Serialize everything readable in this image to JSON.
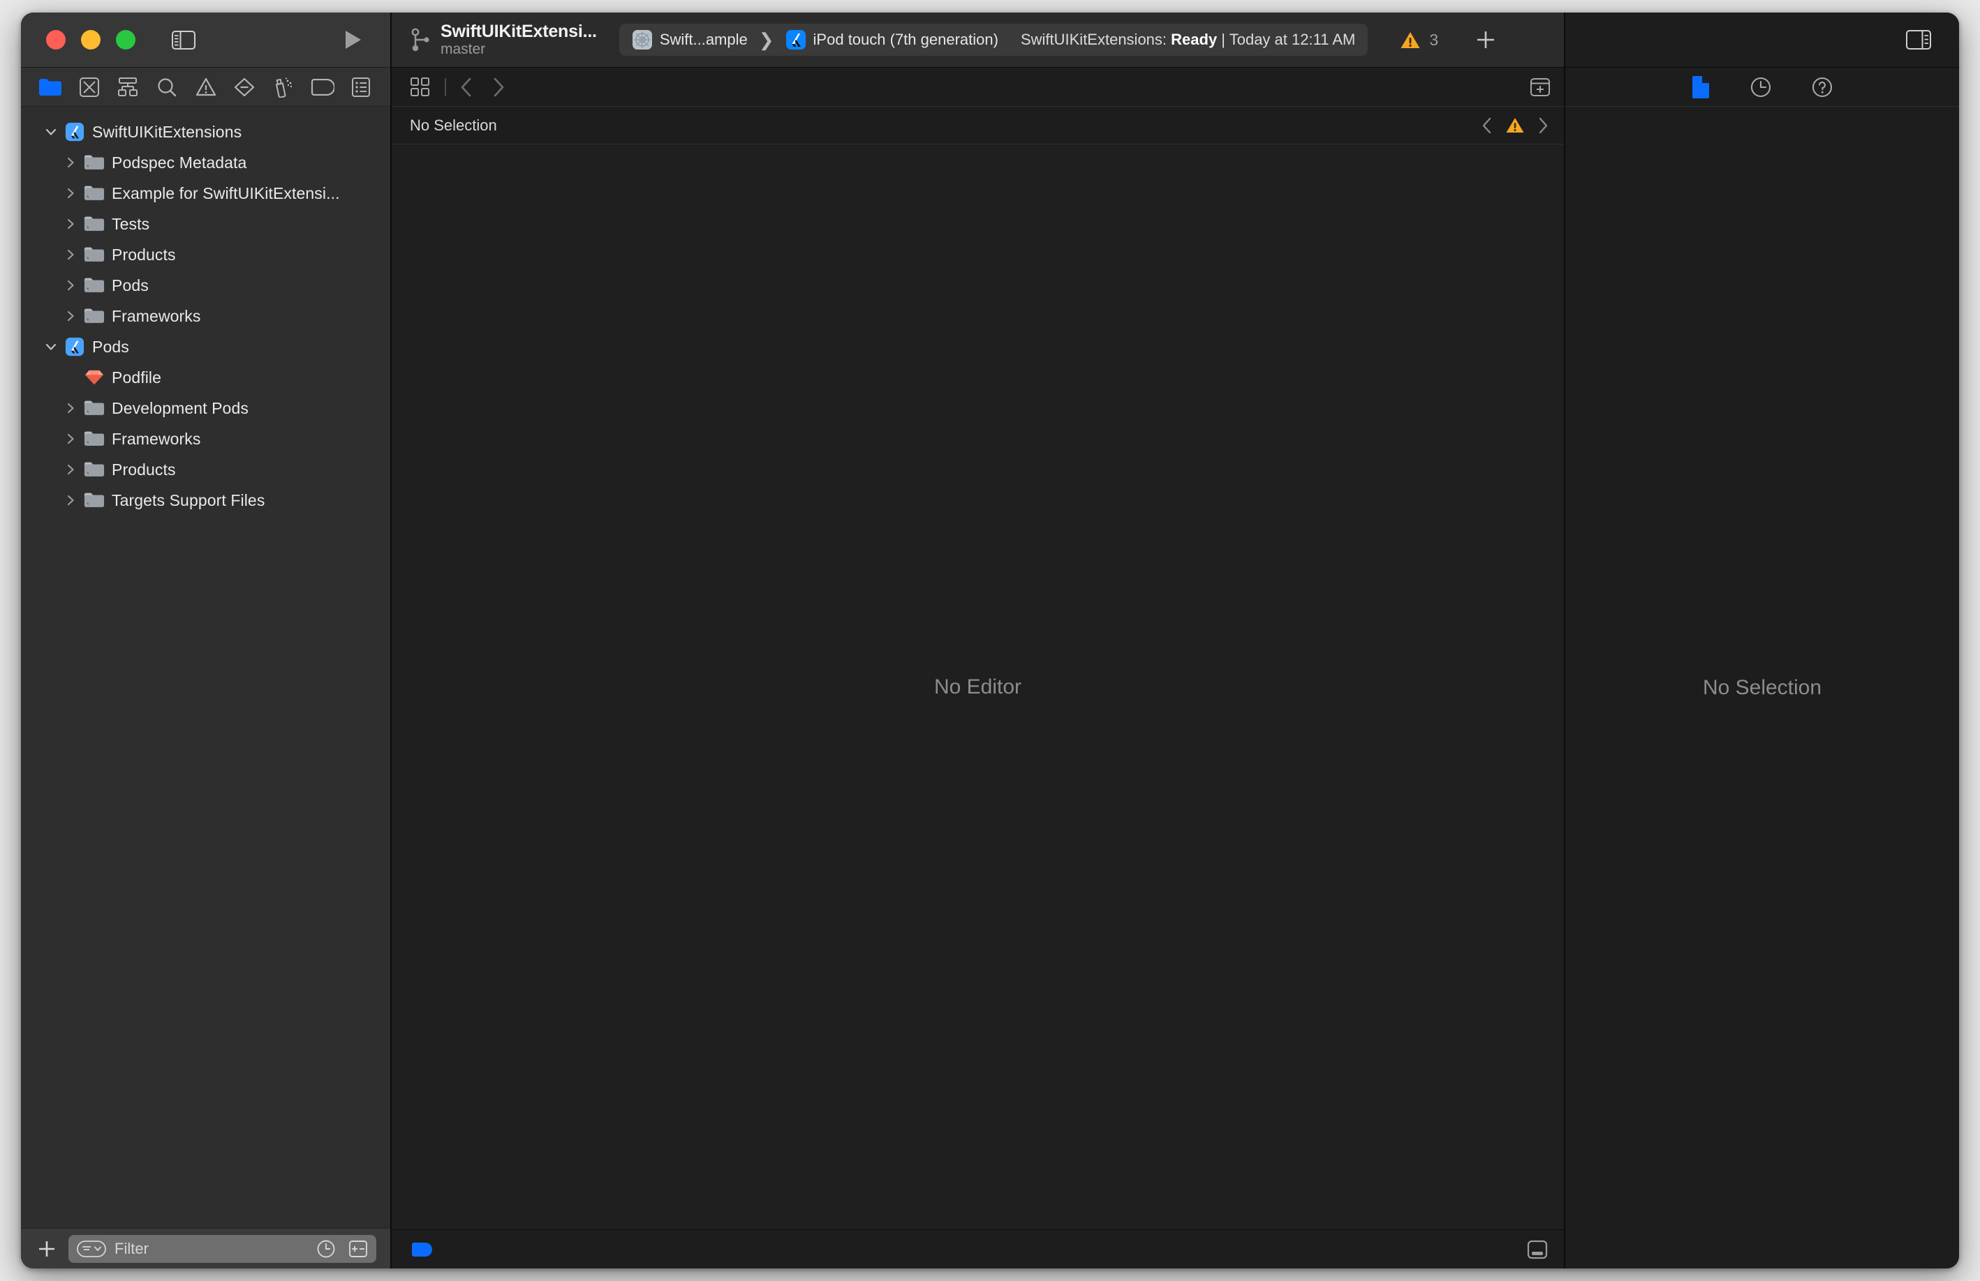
{
  "window": {
    "traffic_lights": [
      "close",
      "minimize",
      "zoom"
    ],
    "colors": {
      "accent_blue": "#0a6cff",
      "warning_yellow": "#f5a623",
      "red": "#fd5f57",
      "yellow": "#febc2e",
      "green": "#29c840",
      "sidebar_bg": "#2e2e2e",
      "editor_bg": "#1f1f1f",
      "titlebar_bg": "#373737"
    }
  },
  "toolbar": {
    "sidebar_toggle_name": "Hide or show the Navigator",
    "run_button_name": "Run",
    "project_name": "SwiftUIKitExtensi...",
    "branch_name": "master",
    "breadcrumbs": [
      {
        "icon": "scheme-icon",
        "label": "Swift...ample"
      },
      {
        "icon": "device-icon",
        "label": "iPod touch (7th generation)"
      }
    ],
    "status_prefix": "SwiftUIKitExtensions: ",
    "status_state": "Ready",
    "status_suffix": " | Today at 12:11 AM",
    "warning_count": "3",
    "add_button_label": "+",
    "inspector_toggle_name": "Hide or show the Inspectors"
  },
  "navigator": {
    "tabs": [
      {
        "name": "project-navigator",
        "icon": "folder-icon",
        "active": true
      },
      {
        "name": "source-control-navigator",
        "icon": "source-control-icon",
        "active": false
      },
      {
        "name": "symbol-navigator",
        "icon": "hierarchy-icon",
        "active": false
      },
      {
        "name": "find-navigator",
        "icon": "search-icon",
        "active": false
      },
      {
        "name": "issue-navigator",
        "icon": "warning-triangle-icon",
        "active": false
      },
      {
        "name": "test-navigator",
        "icon": "diamond-minus-icon",
        "active": false
      },
      {
        "name": "debug-navigator",
        "icon": "spray-can-icon",
        "active": false
      },
      {
        "name": "breakpoint-navigator",
        "icon": "tag-icon",
        "active": false
      },
      {
        "name": "report-navigator",
        "icon": "report-list-icon",
        "active": false
      }
    ],
    "tree": [
      {
        "label": "SwiftUIKitExtensions",
        "icon": "xcode-project-icon",
        "depth": 0,
        "twisty": "down"
      },
      {
        "label": "Podspec Metadata",
        "icon": "folder-icon",
        "depth": 1,
        "twisty": "right"
      },
      {
        "label": "Example for SwiftUIKitExtensi...",
        "icon": "folder-icon",
        "depth": 1,
        "twisty": "right"
      },
      {
        "label": "Tests",
        "icon": "folder-icon",
        "depth": 1,
        "twisty": "right"
      },
      {
        "label": "Products",
        "icon": "folder-icon",
        "depth": 1,
        "twisty": "right"
      },
      {
        "label": "Pods",
        "icon": "folder-icon",
        "depth": 1,
        "twisty": "right"
      },
      {
        "label": "Frameworks",
        "icon": "folder-icon",
        "depth": 1,
        "twisty": "right"
      },
      {
        "label": "Pods",
        "icon": "xcode-project-icon",
        "depth": 0,
        "twisty": "down"
      },
      {
        "label": "Podfile",
        "icon": "ruby-gem-icon",
        "depth": 1,
        "twisty": "none"
      },
      {
        "label": "Development Pods",
        "icon": "folder-icon",
        "depth": 1,
        "twisty": "right"
      },
      {
        "label": "Frameworks",
        "icon": "folder-icon",
        "depth": 1,
        "twisty": "right"
      },
      {
        "label": "Products",
        "icon": "folder-icon",
        "depth": 1,
        "twisty": "right"
      },
      {
        "label": "Targets Support Files",
        "icon": "folder-icon",
        "depth": 1,
        "twisty": "right"
      }
    ],
    "filter_bar": {
      "add_label": "+",
      "placeholder": "Filter",
      "recent_icon": "clock-icon",
      "sourcecontrol_icon": "plus-minus-icon"
    }
  },
  "editor": {
    "jumpbar": {
      "grid_icon": "related-items-icon",
      "back_icon": "chevron-left-icon",
      "forward_icon": "chevron-right-icon",
      "add_editor_icon": "add-editor-icon"
    },
    "selection_label": "No Selection",
    "issue_prev_icon": "chevron-left-icon",
    "issue_icon": "warning-triangle-icon",
    "issue_next_icon": "chevron-right-icon",
    "placeholder": "No Editor",
    "status": {
      "tag_icon": "blue-tag-icon",
      "debug_area_icon": "toggle-debug-area-icon"
    }
  },
  "inspector": {
    "tabs": [
      {
        "name": "file-inspector",
        "icon": "document-icon",
        "active": true
      },
      {
        "name": "history-inspector",
        "icon": "clock-icon",
        "active": false
      },
      {
        "name": "quick-help-inspector",
        "icon": "question-circle-icon",
        "active": false
      }
    ],
    "placeholder": "No Selection"
  }
}
